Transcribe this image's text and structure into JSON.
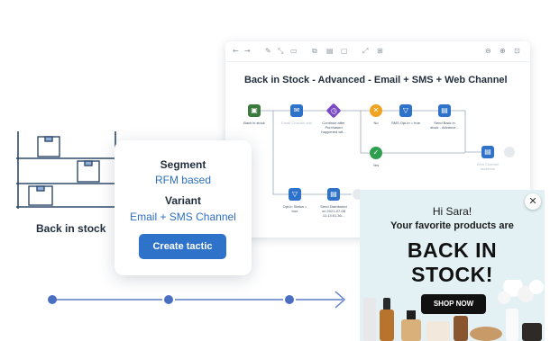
{
  "shelf": {
    "label": "Back in stock"
  },
  "editor": {
    "title": "Back in Stock - Advanced - Email + SMS + Web Channel",
    "toolbar_icons": [
      "back-icon",
      "forward-icon",
      "pen-icon",
      "connector-icon",
      "comment-icon",
      "copy-icon",
      "paste-icon",
      "delete-icon",
      "expand-icon",
      "collapse-icon",
      "zoom-out-icon",
      "zoom-in-icon",
      "fit-icon"
    ],
    "nodes": [
      {
        "name": "back-in-stock-trigger",
        "icon": "shopping-bag-icon",
        "label": "Back in stock",
        "color": "#3a7a3c",
        "faded": false
      },
      {
        "name": "email-step",
        "icon": "email-icon",
        "label": "Email Channel add",
        "color": "#2e73c9",
        "faded": true
      },
      {
        "name": "continue-after-purchased",
        "icon": "clock-icon",
        "label": "Continue after Purchased happened wit...",
        "color": "#7a4bc4",
        "faded": false
      },
      {
        "name": "decision-no",
        "icon": "x-icon",
        "label": "No",
        "color": "#f0a320",
        "faded": false
      },
      {
        "name": "sms-opt-in-filter",
        "icon": "filter-icon",
        "label": "SMS Opt-in = true",
        "color": "#2e73c9",
        "faded": false
      },
      {
        "name": "send-back-in-stock",
        "icon": "message-icon",
        "label": "Send Back in stock - Advance...",
        "color": "#2e73c9",
        "faded": false
      },
      {
        "name": "decision-yes",
        "icon": "check-icon",
        "label": "Yes",
        "color": "#2e9e4f",
        "faded": false
      },
      {
        "name": "web-channel-step",
        "icon": "screen-icon",
        "label": "Web Channel audience",
        "color": "#2e73c9",
        "faded": true
      },
      {
        "name": "opt-in-status-filter",
        "icon": "filter-icon",
        "label": "Opt-in Status = true",
        "color": "#2e73c9",
        "faded": false
      },
      {
        "name": "send-distributed",
        "icon": "message-icon",
        "label": "Send Distributed on 2021-07-08 11:13:51.36...",
        "color": "#2e73c9",
        "faded": false
      }
    ]
  },
  "card": {
    "segment_heading": "Segment",
    "segment_value": "RFM based",
    "variant_heading": "Variant",
    "variant_value": "Email + SMS Channel",
    "button_label": "Create tactic"
  },
  "popup": {
    "greeting": "Hi Sara!",
    "subtitle": "Your favorite products are",
    "headline_1": "BACK IN",
    "headline_2": "STOCK!",
    "button_label": "SHOP NOW",
    "close_symbol": "✕"
  },
  "colors": {
    "accent_blue": "#2e73c9",
    "text_dark": "#1f2d3d",
    "shelf_line": "#2f4a6b",
    "box_blue": "#8fb0d8",
    "timeline": "#5b7fc7",
    "popup_bg": "#e3f1f4"
  }
}
